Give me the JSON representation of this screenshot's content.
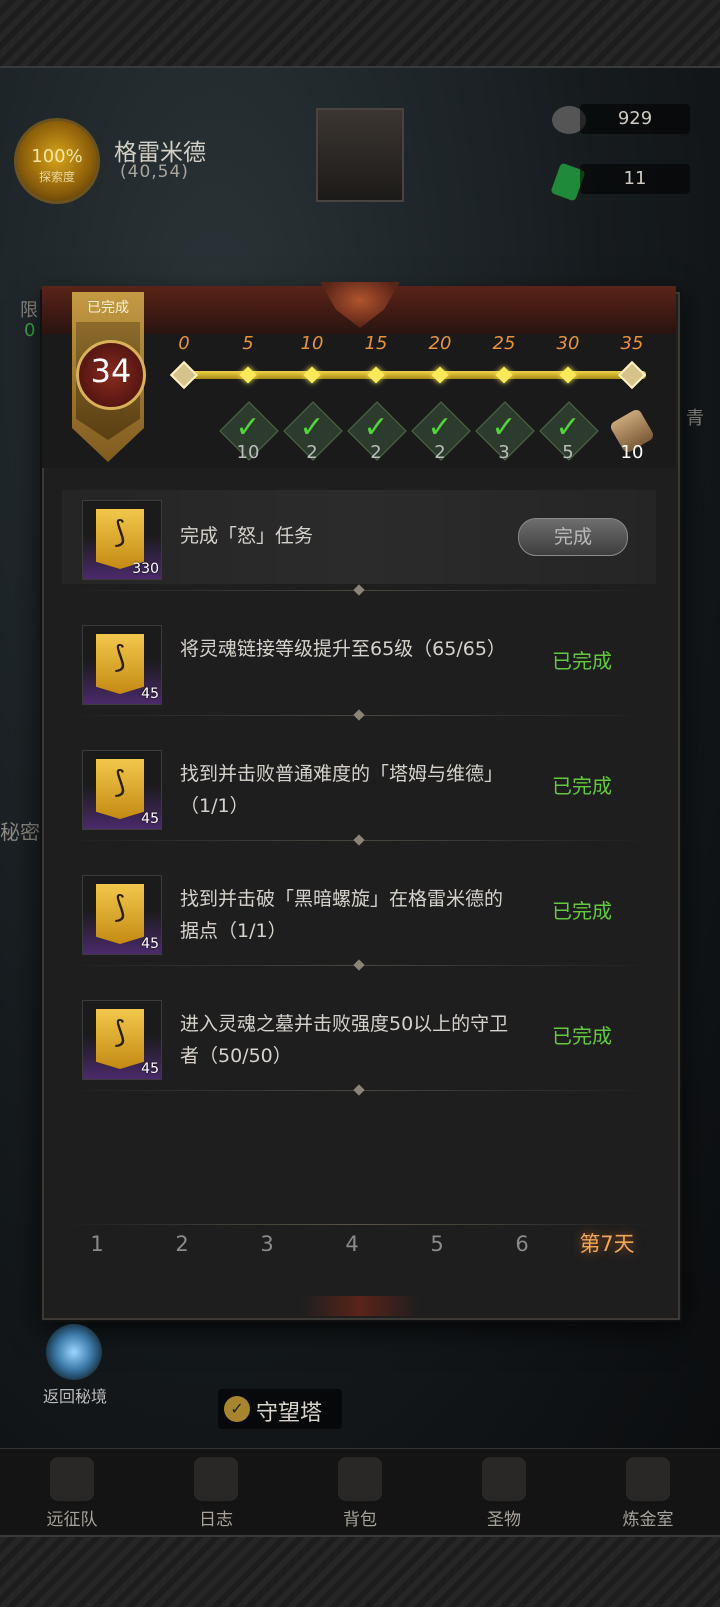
{
  "header": {
    "explore_pct": "100%",
    "explore_label": "探索度",
    "location_name": "格雷米德",
    "location_coords": "(40,54)",
    "currency1": "929",
    "currency2": "11"
  },
  "side": {
    "left_limit": "限",
    "left_limit2": "0",
    "left_secret": "秘密",
    "right_label": "青",
    "portal_label": "返回秘境",
    "tower_label": "守望塔"
  },
  "panel": {
    "status_label": "已完成",
    "level": "34",
    "milestones": [
      "0",
      "5",
      "10",
      "15",
      "20",
      "25",
      "30",
      "35"
    ],
    "rewards": [
      "10",
      "2",
      "2",
      "2",
      "3",
      "5",
      "10"
    ],
    "tasks": [
      {
        "text": "完成「怒」任务",
        "qty": "330",
        "status": "完成",
        "claimable": true
      },
      {
        "text": "将灵魂链接等级提升至65级（65/65）",
        "qty": "45",
        "status": "已完成",
        "claimable": false
      },
      {
        "text": "找到并击败普通难度的「塔姆与维德」（1/1）",
        "qty": "45",
        "status": "已完成",
        "claimable": false
      },
      {
        "text": "找到并击破「黑暗螺旋」在格雷米德的据点（1/1）",
        "qty": "45",
        "status": "已完成",
        "claimable": false
      },
      {
        "text": "进入灵魂之墓并击败强度50以上的守卫者（50/50）",
        "qty": "45",
        "status": "已完成",
        "claimable": false
      }
    ],
    "days": [
      "1",
      "2",
      "3",
      "4",
      "5",
      "6",
      "第7天"
    ]
  },
  "nav": [
    "远征队",
    "日志",
    "背包",
    "圣物",
    "炼金室"
  ],
  "colors": {
    "accent_orange": "#f0a75a",
    "complete_green": "#63c93d",
    "track_gold": "#f1d24a"
  }
}
